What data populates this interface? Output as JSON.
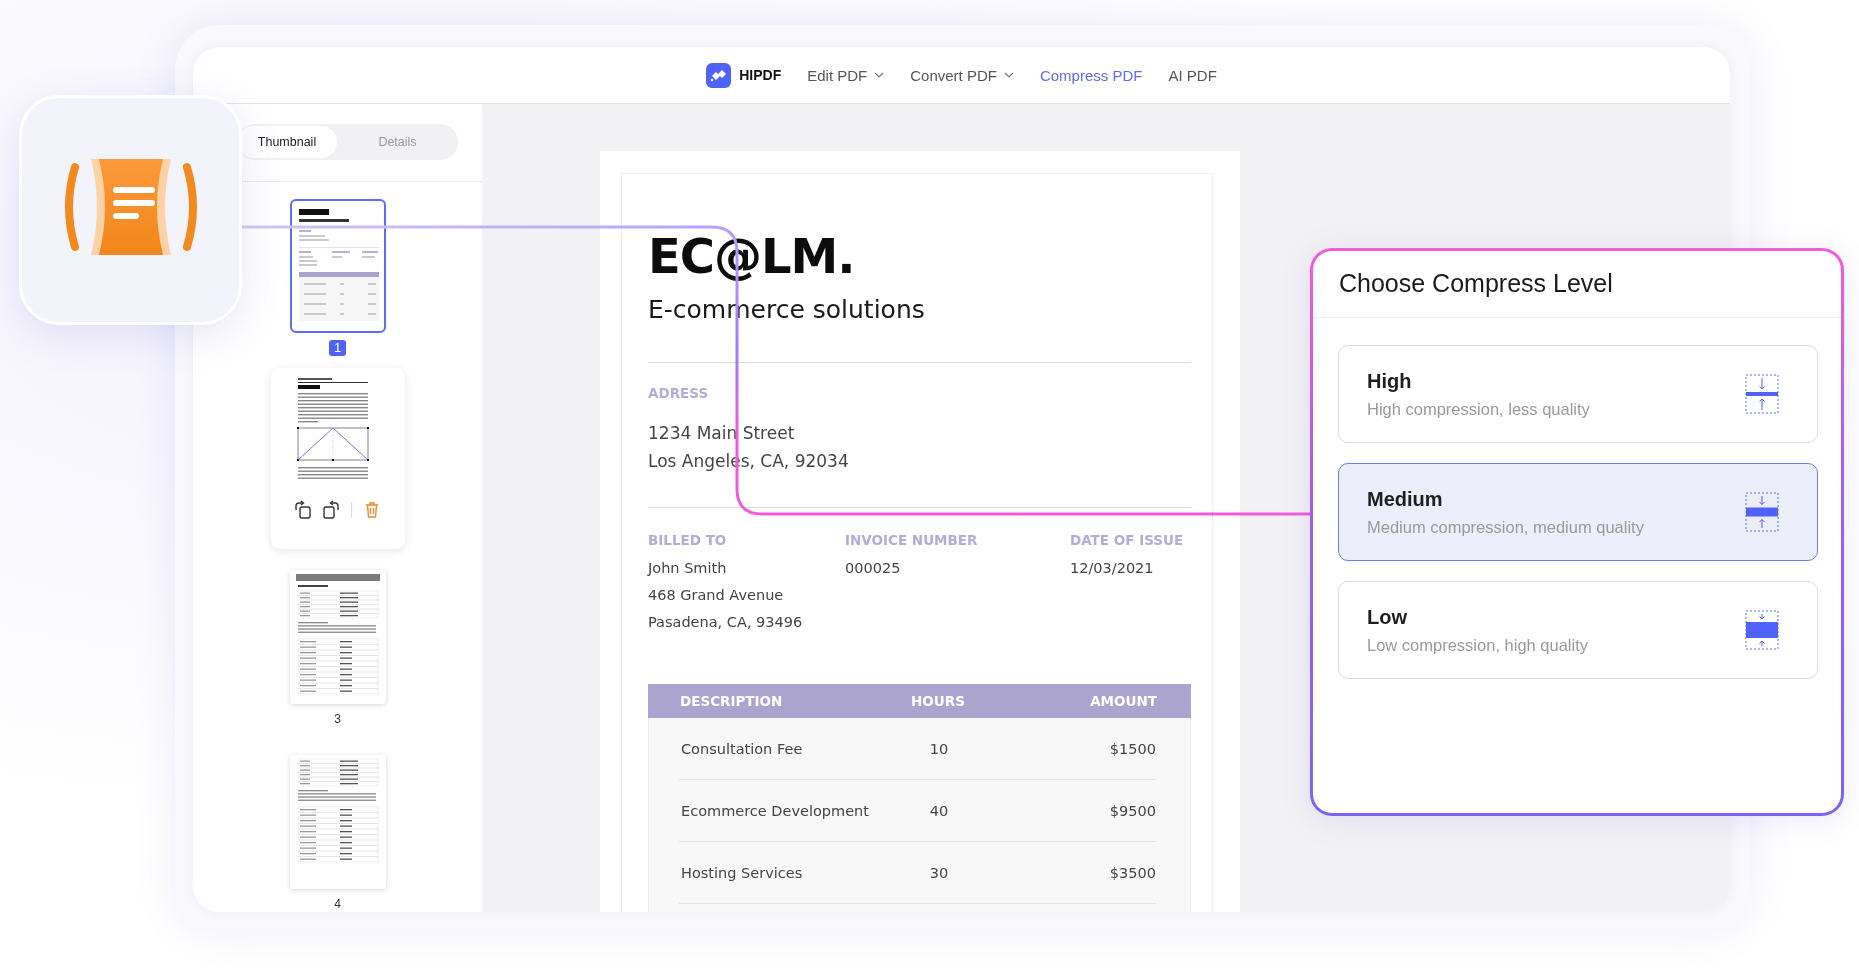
{
  "nav": {
    "brand": "HIPDF",
    "items": [
      {
        "label": "Edit PDF",
        "menu": true,
        "selected": false
      },
      {
        "label": "Convert PDF",
        "menu": true,
        "selected": false
      },
      {
        "label": "Compress PDF",
        "menu": false,
        "selected": true
      },
      {
        "label": "AI PDF",
        "menu": false,
        "selected": false
      }
    ]
  },
  "sidebar": {
    "tabs": [
      {
        "label": "Thumbnail",
        "selected": true
      },
      {
        "label": "Details",
        "selected": false
      }
    ],
    "pages": [
      {
        "number": "1",
        "selected": true,
        "kind": "invoice"
      },
      {
        "selected": false,
        "kind": "chapter",
        "toolbar": true
      },
      {
        "number": "3",
        "selected": false,
        "kind": "letterhead"
      },
      {
        "number": "4",
        "selected": false,
        "kind": "form"
      }
    ]
  },
  "document": {
    "company": "EC@LM.",
    "tagline": "E-commerce solutions",
    "address_label": "ADRESS",
    "address_lines": [
      "1234 Main Street",
      "Los Angeles, CA, 92034"
    ],
    "billing": [
      {
        "label": "BILLED TO",
        "lines": [
          "John Smith",
          "468 Grand Avenue",
          "Pasadena, CA, 93496"
        ]
      },
      {
        "label": "INVOICE NUMBER",
        "lines": [
          "000025"
        ]
      },
      {
        "label": "DATE OF ISSUE",
        "lines": [
          "12/03/2021"
        ]
      }
    ],
    "table": {
      "columns": [
        "DESCRIPTION",
        "HOURS",
        "AMOUNT"
      ],
      "rows": [
        [
          "Consultation Fee",
          "10",
          "$1500"
        ],
        [
          "Ecommerce Development",
          "40",
          "$9500"
        ],
        [
          "Hosting Services",
          "30",
          "$3500"
        ]
      ]
    }
  },
  "compress_panel": {
    "title": "Choose Compress Level",
    "options": [
      {
        "name": "High",
        "description": "High compression, less quality",
        "selected": false,
        "kind": "thin"
      },
      {
        "name": "Medium",
        "description": "Medium compression, medium quality",
        "selected": true,
        "kind": "medium"
      },
      {
        "name": "Low",
        "description": "Low compression, high quality",
        "selected": false,
        "kind": "thick"
      }
    ]
  }
}
